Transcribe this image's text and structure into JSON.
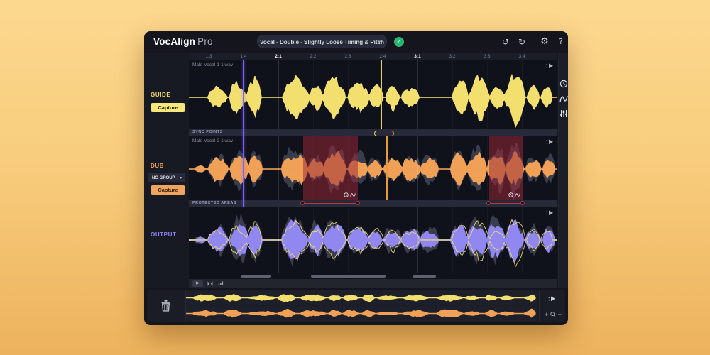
{
  "app": {
    "brand": "VocAlign",
    "brand_suffix": "Pro",
    "preset": "Vocal - Double - Slightly Loose Timing & Pitch",
    "help": "?"
  },
  "icons": {
    "undo": "↺",
    "redo": "↻",
    "settings": "⚙",
    "check": "✓",
    "chevron_down": "▾",
    "play": "▶",
    "zoom_plus": "+",
    "zoom_minus": "−"
  },
  "ruler": {
    "ticks": [
      {
        "label": "1:3",
        "bold": false
      },
      {
        "label": "1:4",
        "bold": false
      },
      {
        "label": "2:1",
        "bold": true
      },
      {
        "label": "2:2",
        "bold": false
      },
      {
        "label": "2:3",
        "bold": false
      },
      {
        "label": "2:4",
        "bold": false
      },
      {
        "label": "3:1",
        "bold": true
      },
      {
        "label": "3:2",
        "bold": false
      },
      {
        "label": "3:3",
        "bold": false
      },
      {
        "label": "3:4",
        "bold": false
      }
    ]
  },
  "sidebar": {
    "guide": {
      "label": "GUIDE",
      "capture": "Capture"
    },
    "dub": {
      "label": "DUB",
      "group": "NO GROUP",
      "capture": "Capture"
    },
    "output": {
      "label": "OUTPUT"
    }
  },
  "tracks": {
    "guide_file": "Male-Vocal-1-1.wav",
    "dub_file": "Male-Vocal-2-1.wav"
  },
  "strips": {
    "sync": "SYNC POINTS",
    "protected": "PROTECTED AREAS"
  },
  "colors": {
    "guide": "#f2df6e",
    "dub": "#f0a156",
    "output": "#9187f0",
    "ghost": "#6f7487",
    "playhead": "#7b61ff",
    "protected": "#c23040",
    "accent_green": "#2ab66f"
  }
}
